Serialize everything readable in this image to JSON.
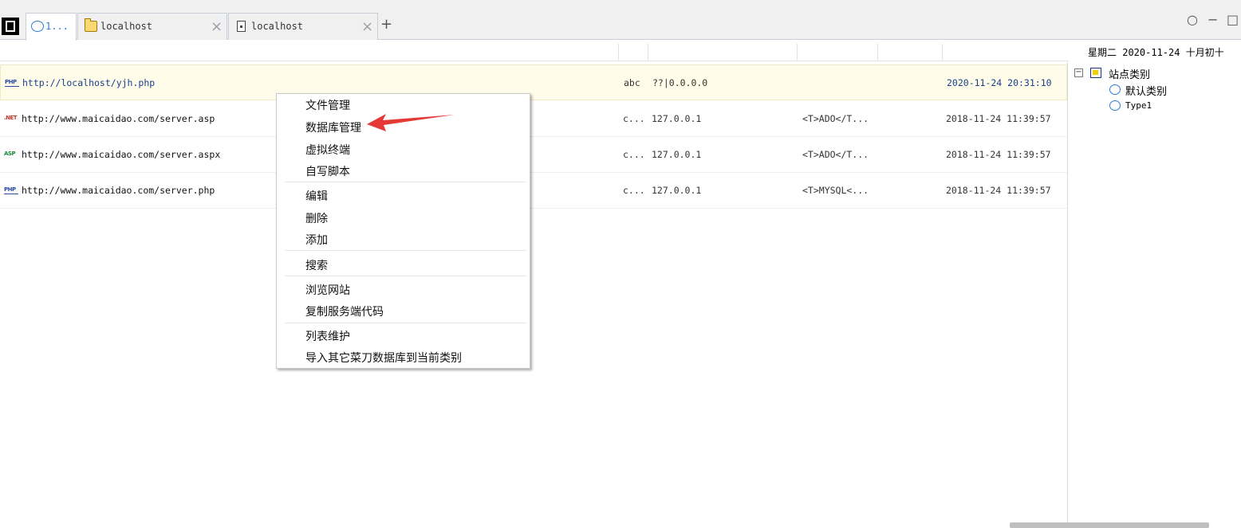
{
  "tabs": [
    {
      "label": "1...",
      "icon": "circle-icon",
      "active": true
    },
    {
      "label": "localhost",
      "icon": "folder-icon",
      "close": "×"
    },
    {
      "label": "localhost",
      "icon": "page-icon",
      "close": "×"
    }
  ],
  "new_tab_label": "+",
  "window_controls": {
    "circle": "○",
    "minimize": "−",
    "maximize": "□"
  },
  "date_bar": "星期二 2020-11-24 十月初十",
  "sites": [
    {
      "type_badge": "PHP",
      "type_icon": "php-icon",
      "url": "http://localhost/yjh.php",
      "note": "abc",
      "ip": "??|0.0.0.0",
      "config": "",
      "time": "2020-11-24 20:31:10"
    },
    {
      "type_badge": ".NET",
      "type_icon": "net-icon",
      "url": "http://www.maicaidao.com/server.asp",
      "note": "c...",
      "ip": "127.0.0.1",
      "config": "<T>ADO</T...",
      "time": "2018-11-24 11:39:57"
    },
    {
      "type_badge": "ASP",
      "type_icon": "asp-icon",
      "url": "http://www.maicaidao.com/server.aspx",
      "note": "c...",
      "ip": "127.0.0.1",
      "config": "<T>ADO</T...",
      "time": "2018-11-24 11:39:57"
    },
    {
      "type_badge": "PHP",
      "type_icon": "php-icon",
      "url": "http://www.maicaidao.com/server.php",
      "note": "c...",
      "ip": "127.0.0.1",
      "config": "<T>MYSQL<...",
      "time": "2018-11-24 11:39:57"
    }
  ],
  "category_tree": {
    "toggle": "−",
    "root": "站点类别",
    "items": [
      "默认类别",
      "Type1"
    ]
  },
  "context_menu": {
    "items": [
      "文件管理",
      "数据库管理",
      "虚拟终端",
      "自写脚本",
      "编辑",
      "删除",
      "添加",
      "搜索",
      "浏览网站",
      "复制服务端代码",
      "列表维护",
      "导入其它菜刀数据库到当前类别"
    ],
    "highlighted_item": "数据库管理",
    "annotation_color": "#e53935"
  }
}
